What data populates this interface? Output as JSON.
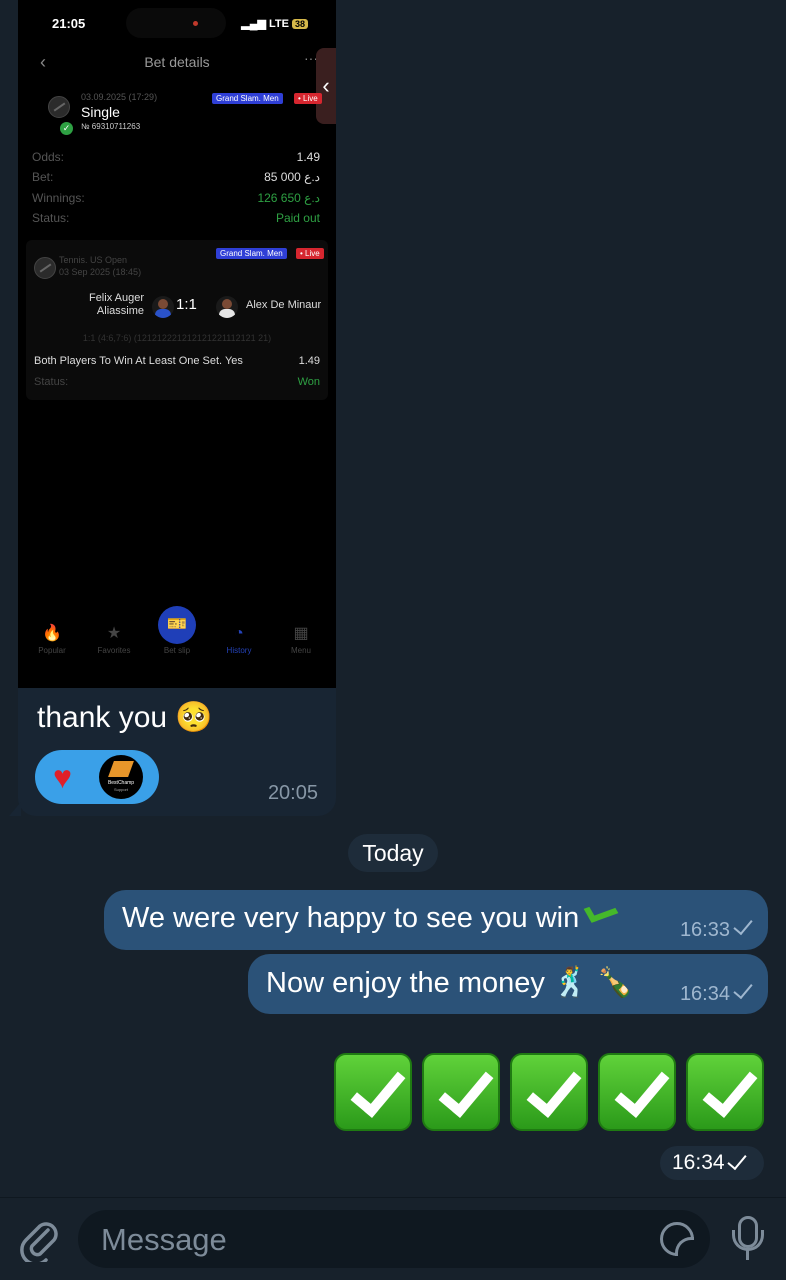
{
  "incoming": {
    "screenshot": {
      "status_time": "21:05",
      "network": "LTE",
      "battery": "38",
      "nav_title": "Bet details",
      "card": {
        "date": "03.09.2025 (17:29)",
        "type": "Single",
        "number": "№ 69310711263",
        "tag_tournament": "Grand Slam. Men",
        "tag_live": "• Live",
        "rows": [
          {
            "label": "Odds:",
            "value": "1.49"
          },
          {
            "label": "Bet:",
            "value": "85 000 د.ع"
          },
          {
            "label": "Winnings:",
            "value": "126 650 د.ع"
          },
          {
            "label": "Status:",
            "value": "Paid out"
          }
        ]
      },
      "event": {
        "sport": "Tennis. US Open",
        "date": "03 Sep 2025 (18:45)",
        "tag_tournament": "Grand Slam. Men",
        "tag_live": "• Live",
        "player1": "Felix Auger Aliassime",
        "player2": "Alex De Minaur",
        "score": "1:1",
        "set_scores": "1:1 (4:6,7:6) (121212221212121221112121 21)",
        "market": "Both Players To Win At Least One Set. Yes",
        "market_odds": "1.49",
        "status_label": "Status:",
        "status_value": "Won"
      },
      "tabs": [
        {
          "label": "Popular"
        },
        {
          "label": "Favorites"
        },
        {
          "label": "Bet slip"
        },
        {
          "label": "History"
        },
        {
          "label": "Menu"
        }
      ]
    },
    "caption": "thank you 🥺",
    "reaction_brand": "BestChamp",
    "reaction_brand_sub": "Support",
    "time": "20:05"
  },
  "date_separator": "Today",
  "outgoing": [
    {
      "text": "We were very happy to see you win",
      "time": "16:33"
    },
    {
      "text": "Now enjoy the money 🕺 🍾",
      "time": "16:34"
    },
    {
      "text": "✅✅✅✅✅",
      "time": "16:34"
    }
  ],
  "composer": {
    "placeholder": "Message"
  },
  "colors": {
    "background": "#17212b",
    "outgoing_bubble": "#2b5278",
    "incoming_bubble": "#182533",
    "reaction_pill": "#3aa0e8"
  }
}
